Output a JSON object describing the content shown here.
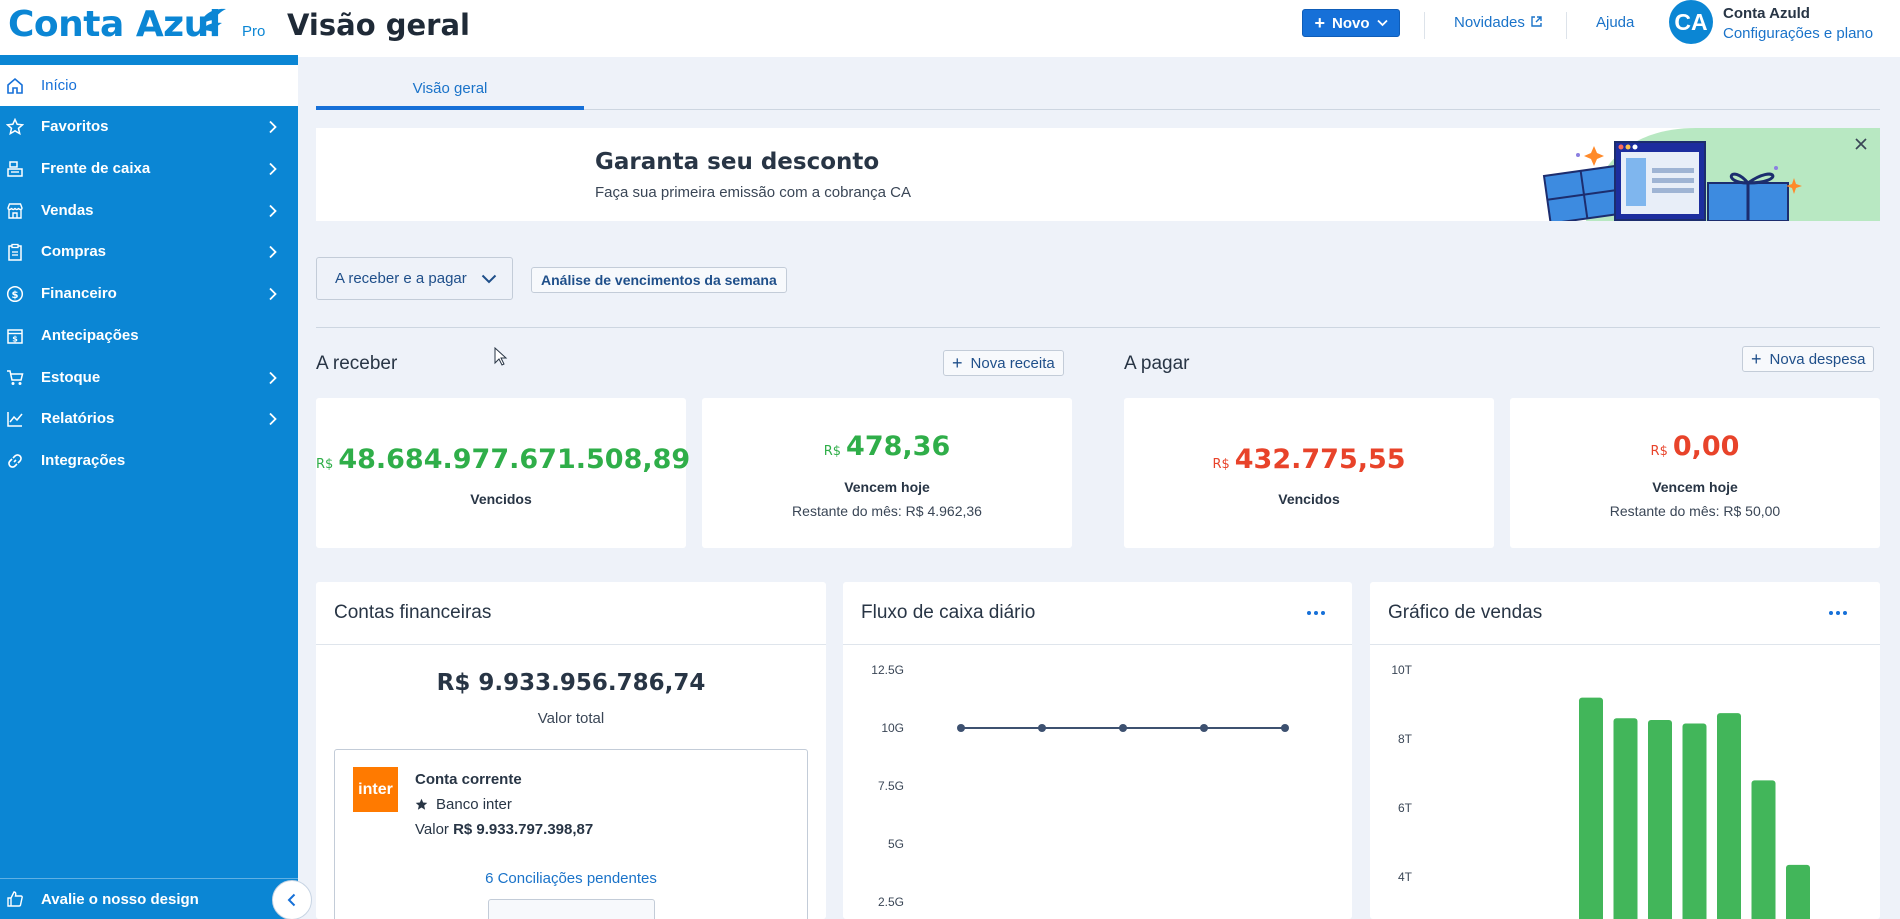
{
  "header": {
    "logo_text": "Conta Azul",
    "logo_badge": "Pro",
    "page_title": "Visão geral",
    "new_button": "Novo",
    "news_link": "Novidades",
    "help_link": "Ajuda",
    "avatar_initials": "CA",
    "user_name": "Conta Azuld",
    "user_settings": "Configurações e plano"
  },
  "sidebar": {
    "items": [
      {
        "label": "Início",
        "icon": "home-icon",
        "active": true
      },
      {
        "label": "Favoritos",
        "icon": "star-icon"
      },
      {
        "label": "Frente de caixa",
        "icon": "cash-register-icon"
      },
      {
        "label": "Vendas",
        "icon": "store-icon"
      },
      {
        "label": "Compras",
        "icon": "clipboard-icon"
      },
      {
        "label": "Financeiro",
        "icon": "dollar-icon"
      },
      {
        "label": "Antecipações",
        "icon": "calendar-dollar-icon"
      },
      {
        "label": "Estoque",
        "icon": "cart-icon"
      },
      {
        "label": "Relatórios",
        "icon": "chart-line-icon"
      },
      {
        "label": "Integrações",
        "icon": "link-icon"
      }
    ],
    "feedback": "Avalie o nosso design"
  },
  "tabs": [
    {
      "label": "Visão geral"
    }
  ],
  "banner": {
    "title": "Garanta seu desconto",
    "subtitle": "Faça sua primeira emissão com a cobrança CA"
  },
  "filters": {
    "period_select": "A receber e a pagar",
    "analysis_button": "Análise de vencimentos da semana"
  },
  "receivable": {
    "title": "A receber",
    "add_button": "Nova receita",
    "overdue": {
      "currency": "R$",
      "amount": "48.684.977.671.508,89",
      "label": "Vencidos"
    },
    "today": {
      "currency": "R$",
      "amount": "478,36",
      "label": "Vencem hoje",
      "rest": "Restante do mês: R$ 4.962,36"
    }
  },
  "payable": {
    "title": "A pagar",
    "add_button": "Nova despesa",
    "overdue": {
      "currency": "R$",
      "amount": "432.775,55",
      "label": "Vencidos"
    },
    "today": {
      "currency": "R$",
      "amount": "0,00",
      "label": "Vencem hoje",
      "rest": "Restante do mês: R$ 50,00"
    }
  },
  "accounts": {
    "title": "Contas financeiras",
    "total": "R$ 9.933.956.786,74",
    "total_label": "Valor total",
    "account": {
      "logo": "inter",
      "name": "Conta corrente",
      "bank": "Banco inter",
      "value_label": "Valor",
      "value": "R$ 9.933.797.398,87",
      "pending": "6 Conciliações pendentes"
    }
  },
  "colors": {
    "brand": "#0b86d4",
    "primary_button": "#1670d8",
    "positive": "#2fae49",
    "negative": "#e8432a",
    "cashflow_line": "#3d5170"
  },
  "chart_data": [
    {
      "type": "line",
      "title": "Fluxo de caixa diário",
      "y_ticks": [
        "12.5G",
        "10G",
        "7.5G",
        "5G",
        "2.5G"
      ],
      "ylim": [
        2.5,
        12.5
      ],
      "x": [
        1,
        2,
        3,
        4,
        5
      ],
      "series": [
        {
          "values": [
            10,
            10,
            10,
            10,
            10
          ]
        }
      ],
      "grid": false
    },
    {
      "type": "bar",
      "title": "Gráfico de vendas",
      "y_ticks": [
        "10T",
        "8T",
        "6T",
        "4T"
      ],
      "ylim": [
        4,
        10
      ],
      "values": [
        9.2,
        8.6,
        8.55,
        8.45,
        8.75,
        6.8,
        4.35
      ],
      "bar_color": "#42b65a",
      "grid": false
    }
  ]
}
